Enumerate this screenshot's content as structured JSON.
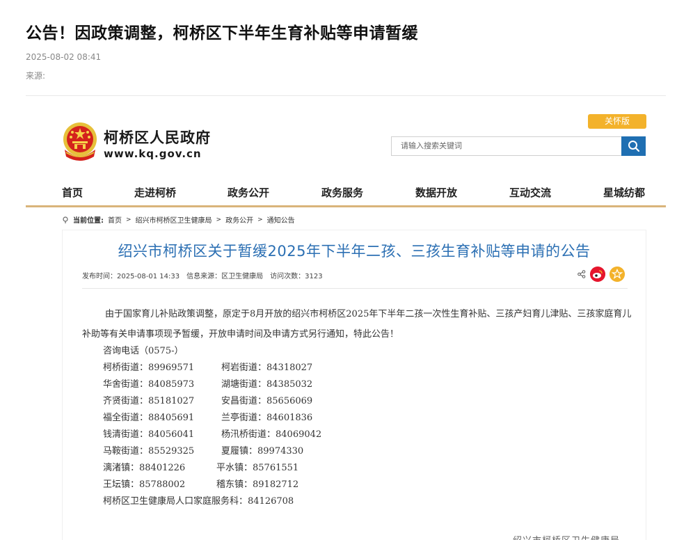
{
  "article": {
    "title": "公告！因政策调整，柯桥区下半年生育补贴等申请暂缓",
    "date": "2025-08-02 08:41",
    "source_label": "来源:"
  },
  "site": {
    "name": "柯桥区人民政府",
    "url": "www.kq.gov.cn",
    "care_label": "关怀版",
    "search_placeholder": "请输入搜索关键词"
  },
  "nav": {
    "items": [
      "首页",
      "走进柯桥",
      "政务公开",
      "政务服务",
      "数据开放",
      "互动交流",
      "星城纺都"
    ]
  },
  "breadcrumb": {
    "label": "当前位置:",
    "items": [
      "首页",
      "绍兴市柯桥区卫生健康局",
      "政务公开",
      "通知公告"
    ],
    "sep": ">"
  },
  "notice": {
    "title": "绍兴市柯桥区关于暂缓2025年下半年二孩、三孩生育补贴等申请的公告",
    "publish_time": "发布时间：2025-08-01 14:33",
    "source": "信息来源：区卫生健康局",
    "visits": "访问次数：3123",
    "body_part1": "由于国家育儿补贴政策调整，原定于8月开放的绍兴市柯桥区2025年下半年",
    "body_emph1": "二孩一次性生育补贴、三孩产妇育儿津贴、三孩家庭育儿补助",
    "body_part2": "等有关申请事项现予暂缓，开放申请时间及申请方式另行通知，特此公告！",
    "consult_label": "咨询电话（0575-）",
    "contacts": [
      [
        "柯桥街道：89969571",
        "柯岩街道：84318027"
      ],
      [
        "华舍街道：84085973",
        "湖塘街道：84385032"
      ],
      [
        "齐贤街道：85181027",
        "安昌街道：85656069"
      ],
      [
        "福全街道：88405691",
        "兰亭街道：84601836"
      ],
      [
        "钱清街道：84056041",
        "杨汛桥街道：84069042"
      ],
      [
        "马鞍街道：85529325",
        "夏履镇：89974330"
      ],
      [
        "漓渚镇：88401226",
        "平水镇：85761551"
      ],
      [
        "王坛镇：85788002",
        "稽东镇：89182712"
      ]
    ],
    "contact_last": "柯桥区卫生健康局人口家庭服务科：84126708",
    "signoff": "绍兴市柯桥区卫生健康局"
  },
  "colors": {
    "title_blue": "#2b6fb3",
    "care_yellow": "#f3b22b",
    "search_blue": "#1f6fb2",
    "nav_rule": "#d9b47a",
    "weibo_red": "#e6162d"
  }
}
